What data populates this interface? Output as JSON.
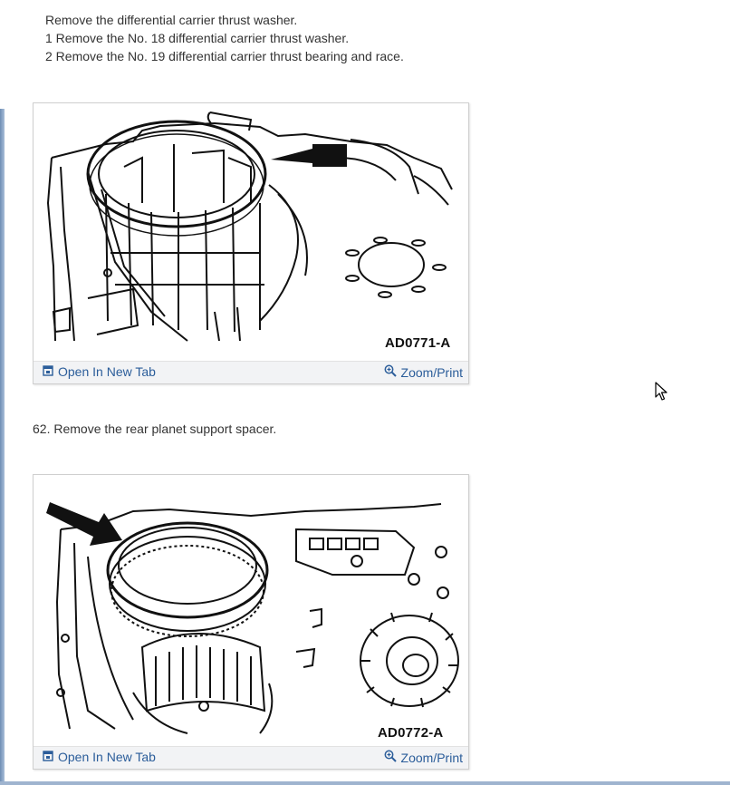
{
  "steps": {
    "intro": "Remove the differential carrier thrust washer.",
    "sub1": "1  Remove the No. 18 differential carrier thrust washer.",
    "sub2": "2  Remove the No. 19 differential carrier thrust bearing and race.",
    "step62": "62. Remove the rear planet support spacer."
  },
  "figures": [
    {
      "code": "AD0771-A",
      "open_label": "Open In New Tab",
      "zoom_label": "Zoom/Print"
    },
    {
      "code": "AD0772-A",
      "open_label": "Open In New Tab",
      "zoom_label": "Zoom/Print"
    }
  ],
  "icons": {
    "open_tab": "open-new-tab-icon",
    "zoom": "magnifier-zoom-icon",
    "cursor": "mouse-pointer-icon"
  },
  "colors": {
    "link": "#2b5d9a",
    "text": "#333333",
    "bar": "#f2f3f5"
  }
}
